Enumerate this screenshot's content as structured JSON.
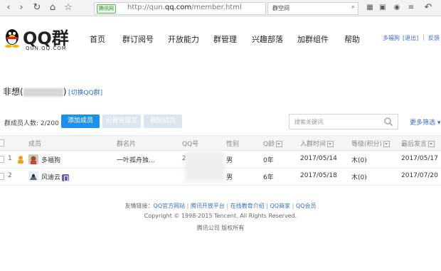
{
  "browser": {
    "secure_label": "腾讯网",
    "url_prefix": "http://qun.",
    "url_domain": "qq.com",
    "url_suffix": "/member.html",
    "search_text": "群空间"
  },
  "header": {
    "logo_text": "QQ群",
    "logo_sub": "QUN.QQ.COM",
    "menu": [
      "首页",
      "群订阅号",
      "开放能力",
      "群管理",
      "兴趣部落",
      "加群组件",
      "帮助"
    ],
    "active_menu": "群管理",
    "user_link": "多福狗",
    "logout_link": "[退出]",
    "feedback_link": "反馈"
  },
  "group": {
    "title_prefix": "非想(",
    "title_suffix": ")",
    "switch_link": "[切换QQ群]"
  },
  "toolbar": {
    "member_count": "群成员人数: 2/200",
    "add_member": "添加成员",
    "set_admin": "设置管理员",
    "delete_member": "删除成员",
    "search_placeholder": "搜索关键词",
    "more_filter": "更多筛选 ▾"
  },
  "table": {
    "headers": [
      "成员",
      "群名片",
      "QQ号",
      "性别",
      "Q龄",
      "入群时间",
      "等级(积分)",
      "最后发言"
    ],
    "rows": [
      {
        "index": "1",
        "name": "多福狗",
        "card": "一叶孤舟独...",
        "qq": "2",
        "gender": "男",
        "qage": "0年",
        "join": "2017/05/14",
        "level": "木(0)",
        "last": "2017/05/17"
      },
      {
        "index": "2",
        "name": "风迪云",
        "card": "",
        "qq": "",
        "gender": "男",
        "qage": "6年",
        "join": "2017/05/18",
        "level": "木(0)",
        "last": "2017/07/20"
      }
    ]
  },
  "footer": {
    "links_label": "友情链接：",
    "links": [
      "QQ官方网站",
      "腾讯开放平台",
      "在线教育介绍",
      "QQ商家",
      "QQ会员"
    ],
    "copyright": "Copyright © 1998-2015 Tencent. All Rights Reserved.",
    "company": "腾讯公司 版权所有"
  },
  "colors": {
    "accent": "#1e90e8",
    "link": "#3a6dc1"
  }
}
